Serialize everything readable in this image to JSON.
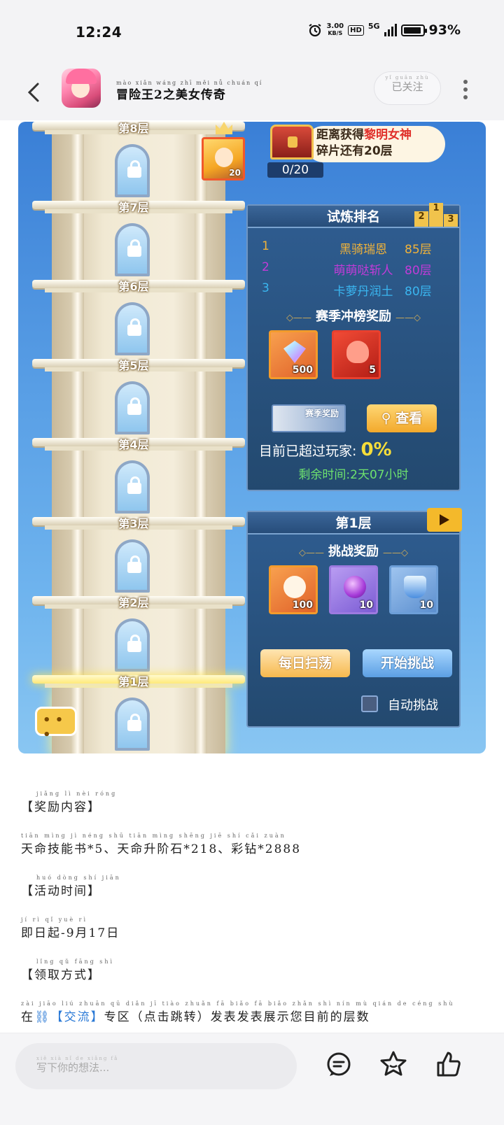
{
  "status_bar": {
    "time": "12:24",
    "net_speed": "3.00",
    "net_unit": "KB/S",
    "hd": "HD",
    "network": "5G",
    "battery": "93%"
  },
  "header": {
    "title": "冒险王2之美女传奇",
    "title_pinyin": "mào xiǎn wáng zhī měi nǚ chuán qí",
    "follow_label": "已关注",
    "follow_pinyin": "yǐ guān zhù"
  },
  "game": {
    "floors": [
      "第8层",
      "第7层",
      "第6层",
      "第5层",
      "第4层",
      "第3层",
      "第2层",
      "第1层"
    ],
    "hero_level": "20",
    "goal_prefix": "距离获得",
    "goal_highlight": "黎明女神",
    "goal_suffix": "碎片还有20层",
    "goal_progress": "0/20",
    "ranking": {
      "title": "试炼排名",
      "podium": [
        "2",
        "1",
        "3"
      ],
      "rows": [
        {
          "rank": "1",
          "name": "黑骑瑞恩",
          "floor": "85层",
          "color": "#f0b23a"
        },
        {
          "rank": "2",
          "name": "萌萌哒斩人",
          "floor": "80层",
          "color": "#c23bd8"
        },
        {
          "rank": "3",
          "name": "卡萝丹润土",
          "floor": "80层",
          "color": "#3ab6f0"
        }
      ],
      "season_title": "赛季冲榜奖励",
      "season_items": [
        {
          "icon": "diamond-icon",
          "count": "500"
        },
        {
          "icon": "flame-essence-icon",
          "count": "5"
        }
      ],
      "season_button": "赛季奖励",
      "view_button": "查看",
      "beat_label": "目前已超过玩家:",
      "beat_value": "0%",
      "remaining": "剩余时间:2天07小时"
    },
    "challenge": {
      "title": "第1层",
      "subtitle": "挑战奖励",
      "items": [
        {
          "icon": "skull-flame-icon",
          "count": "100"
        },
        {
          "icon": "purple-orb-icon",
          "count": "10"
        },
        {
          "icon": "potion-icon",
          "count": "10"
        }
      ],
      "sweep_button": "每日扫荡",
      "start_button": "开始挑战",
      "auto_label": "自动挑战"
    }
  },
  "article": {
    "p1_pinyin": "jiǎng lì nèi róng",
    "p1": "【奖励内容】",
    "p2_pinyin": "tiān mìng jì néng shū      tiān mìng shēng jiē shí       cǎi zuàn",
    "p2": "天命技能书*5、天命升阶石*218、彩钻*2888",
    "p3_pinyin": "huó dòng shí jiān",
    "p3": "【活动时间】",
    "p4_pinyin": "jí rì qǐ    yuè   rì",
    "p4": "即日起-9月17日",
    "p5_pinyin": "lǐng qǔ fāng shì",
    "p5": "【领取方式】",
    "p6_pinyin": "zài      jiāo liú    zhuān qū   diǎn jī tiào zhuǎn   fā biǎo fā biǎo zhǎn shì nín mù qián de céng shù",
    "p6_pre": "在",
    "p6_link": "【交流】",
    "p6_post": "专区（点击跳转）发表发表展示您目前的层数"
  },
  "bottom_bar": {
    "comment_placeholder": "写下你的想法...",
    "comment_pinyin": "xiě xià nǐ de xiǎng fǎ"
  }
}
